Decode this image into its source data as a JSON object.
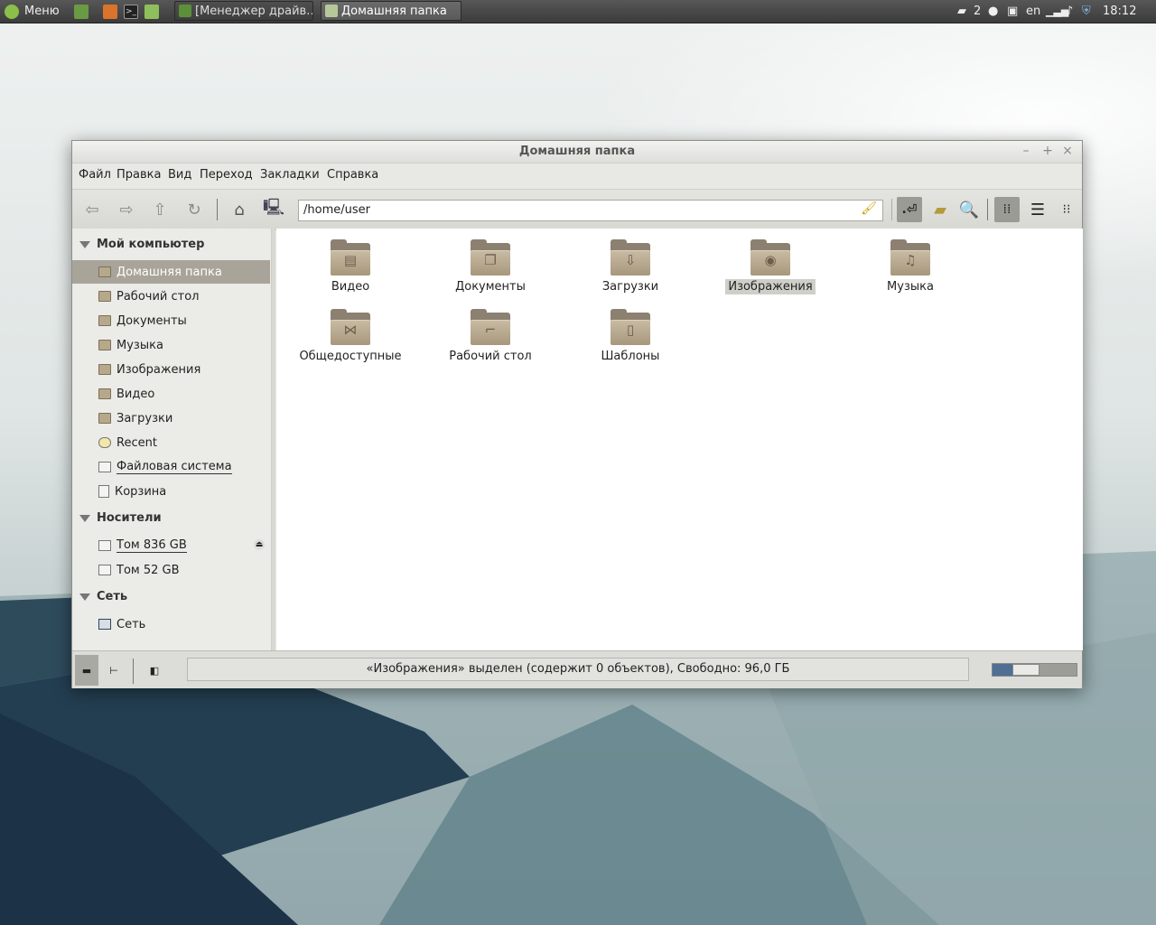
{
  "panel": {
    "menu_label": "Меню",
    "tasks": [
      {
        "label": "[Менеджер драйв…"
      },
      {
        "label": "Домашняя папка"
      }
    ],
    "notifications_count": "2",
    "keyboard_layout": "en",
    "clock": "18:12"
  },
  "window": {
    "title": "Домашняя папка",
    "menu": [
      "Файл",
      "Правка",
      "Вид",
      "Переход",
      "Закладки",
      "Справка"
    ],
    "location": "/home/user"
  },
  "sidebar": {
    "sections": [
      {
        "title": "Мой компьютер",
        "items": [
          {
            "label": "Домашняя папка",
            "selected": true
          },
          {
            "label": "Рабочий стол"
          },
          {
            "label": "Документы"
          },
          {
            "label": "Музыка"
          },
          {
            "label": "Изображения"
          },
          {
            "label": "Видео"
          },
          {
            "label": "Загрузки"
          },
          {
            "label": "Recent"
          },
          {
            "label": "Файловая система"
          },
          {
            "label": "Корзина"
          }
        ]
      },
      {
        "title": "Носители",
        "items": [
          {
            "label": "Том 836 GB"
          },
          {
            "label": "Том 52 GB"
          }
        ]
      },
      {
        "title": "Сеть",
        "items": [
          {
            "label": "Сеть"
          }
        ]
      }
    ]
  },
  "files": [
    {
      "name": "Видео",
      "icon": "folder-video-icon"
    },
    {
      "name": "Документы",
      "icon": "folder-documents-icon"
    },
    {
      "name": "Загрузки",
      "icon": "folder-downloads-icon"
    },
    {
      "name": "Изображения",
      "icon": "folder-pictures-icon",
      "selected": true
    },
    {
      "name": "Музыка",
      "icon": "folder-music-icon"
    },
    {
      "name": "Общедоступные",
      "icon": "folder-public-icon"
    },
    {
      "name": "Рабочий стол",
      "icon": "folder-desktop-icon"
    },
    {
      "name": "Шаблоны",
      "icon": "folder-templates-icon"
    }
  ],
  "status": {
    "text": "«Изображения» выделен (содержит 0 объектов), Свободно: 96,0 ГБ",
    "zoom_level": 0.35
  },
  "colors": {
    "folder": "#b6a88a",
    "selection": "#a8a49a",
    "accent": "#4f6f93"
  }
}
